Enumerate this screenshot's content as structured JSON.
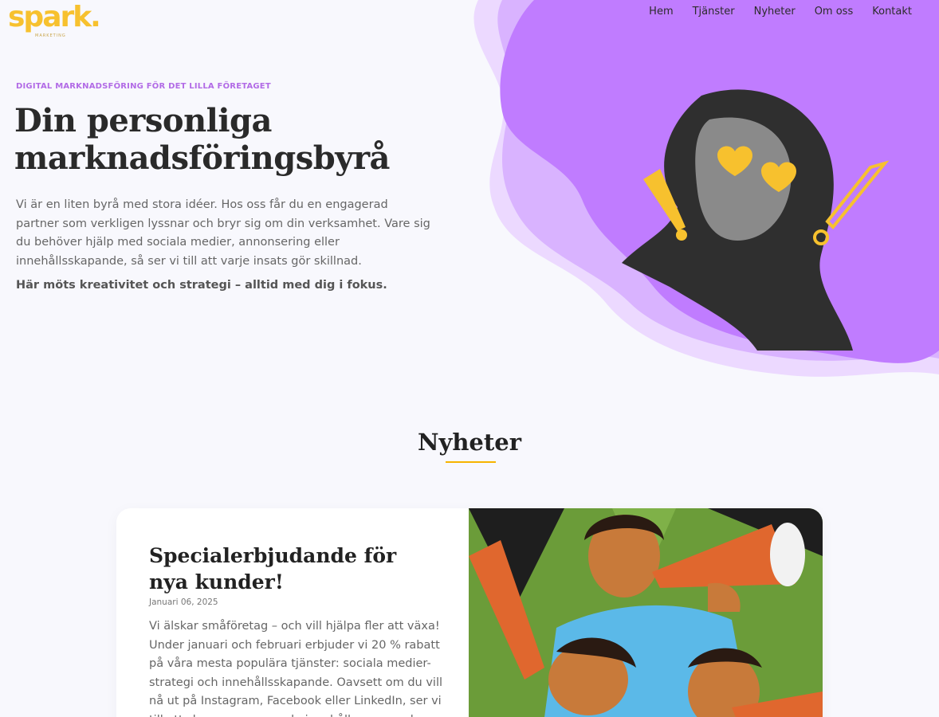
{
  "brand": {
    "logo_text": "spark.",
    "logo_sub": "MARKETING",
    "accent_yellow": "#f7c12e",
    "accent_purple": "#c07cff"
  },
  "nav": {
    "items": [
      {
        "label": "Hem"
      },
      {
        "label": "Tjänster"
      },
      {
        "label": "Nyheter"
      },
      {
        "label": "Om oss"
      },
      {
        "label": "Kontakt"
      }
    ]
  },
  "hero": {
    "eyebrow": "DIGITAL MARKNADSFÖRING FÖR DET LILLA FÖRETAGET",
    "title": "Din personliga marknadsföringsbyrå",
    "body": "Vi är en liten byrå med stora idéer. Hos oss får du en engagerad partner som verkligen lyssnar och bryr sig om din verksamhet. Vare sig du behöver hjälp med sociala medier, annonsering eller innehållsskapande, så ser vi till att varje insats gör skillnad.",
    "strong": "Här möts kreativitet och strategi – alltid med dig i fokus.",
    "image_icon": "woman-heart-glasses-illustration"
  },
  "news": {
    "heading": "Nyheter",
    "card": {
      "title": "Specialerbjudande för nya kunder!",
      "date": "Januari 06, 2025",
      "text": "Vi älskar småföretag – och vill hjälpa fler att växa! Under januari och februari erbjuder vi 20 % rabatt på våra mesta populära tjänster: sociala medier-strategi och innehållsskapande. Oavsett om du vill nå ut på Instagram, Facebook eller LinkedIn, ser vi till att skapa engagerande innehåll som speglar din",
      "image_icon": "megaphone-people-illustration"
    }
  }
}
